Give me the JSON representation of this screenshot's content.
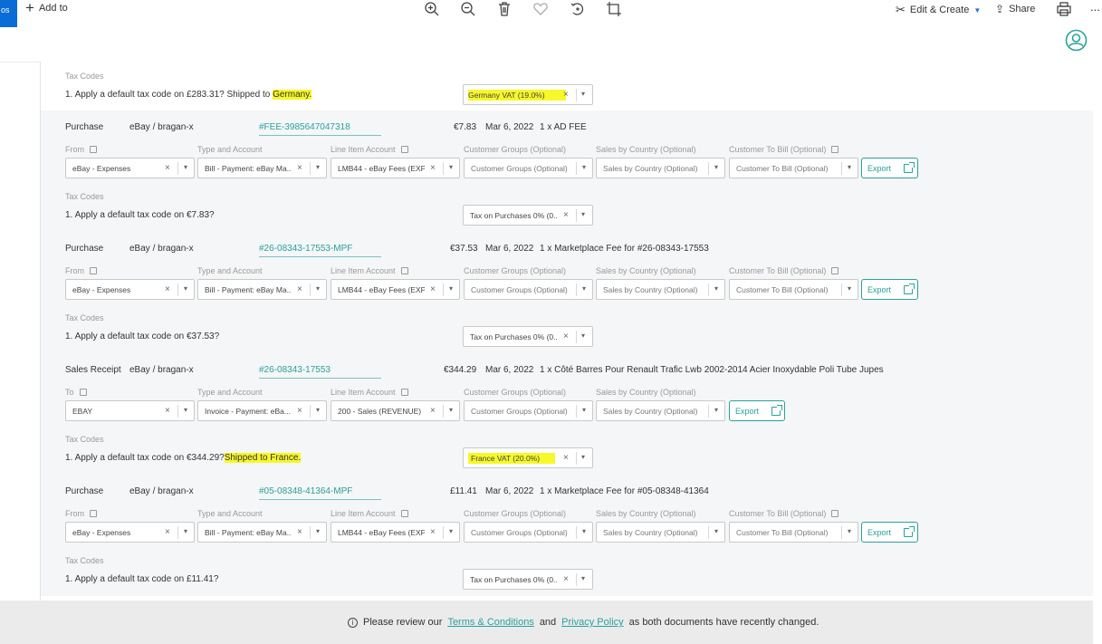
{
  "toolbar": {
    "left_fragment": "os",
    "add_to": "Add to",
    "edit_create": "Edit & Create",
    "share": "Share",
    "more": "..."
  },
  "first_tax": {
    "label": "Tax Codes",
    "question_prefix": "1. Apply a default tax code on £283.31? Shipped to ",
    "question_highlight": "Germany.",
    "select": "Germany VAT (19.0%)"
  },
  "labels": {
    "from": "From",
    "to": "To",
    "type_account": "Type and Account",
    "line_item": "Line Item Account",
    "customer_groups": "Customer Groups (Optional)",
    "sales_country": "Sales by Country (Optional)",
    "customer_bill": "Customer To Bill (Optional)",
    "tax_codes": "Tax Codes",
    "export": "Export"
  },
  "transactions": [
    {
      "type": "Purchase",
      "account": "eBay / bragan-x",
      "ref": "#FEE-3985647047318",
      "amount": "€7.83",
      "date": "Mar 6, 2022",
      "desc": "1 x AD FEE",
      "from": "eBay - Expenses",
      "type_account": "Bill - Payment: eBay Ma...",
      "line_item": "LMB44 - eBay Fees (EXP...",
      "customer_groups": "Customer Groups (Optional)",
      "sales_country": "Sales by Country (Optional)",
      "customer_bill": "Customer To Bill (Optional)",
      "tax_q": "1. Apply a default tax code on €7.83?",
      "tax_q_hl": "",
      "tax_code": "Tax on Purchases 0% (0...."
    },
    {
      "type": "Purchase",
      "account": "eBay / bragan-x",
      "ref": "#26-08343-17553-MPF",
      "amount": "€37.53",
      "date": "Mar 6, 2022",
      "desc": "1 x Marketplace Fee for #26-08343-17553",
      "from": "eBay - Expenses",
      "type_account": "Bill - Payment: eBay Ma...",
      "line_item": "LMB44 - eBay Fees (EXP...",
      "customer_groups": "Customer Groups (Optional)",
      "sales_country": "Sales by Country (Optional)",
      "customer_bill": "Customer To Bill (Optional)",
      "tax_q": "1. Apply a default tax code on €37.53?",
      "tax_q_hl": "",
      "tax_code": "Tax on Purchases 0% (0...."
    },
    {
      "type": "Sales Receipt",
      "account": "eBay / bragan-x",
      "ref": "#26-08343-17553",
      "amount": "€344.29",
      "date": "Mar 6, 2022",
      "desc": "1 x Côté Barres Pour Renault Trafic Lwb 2002-2014 Acier Inoxydable Poli Tube Jupes",
      "from": "EBAY",
      "type_account": "Invoice - Payment: eBa...",
      "line_item": "200 - Sales (REVENUE)",
      "customer_groups": "Customer Groups (Optional)",
      "sales_country": "Sales by Country (Optional)",
      "customer_bill": "",
      "tax_q": "1. Apply a default tax code on €344.29?",
      "tax_q_hl": "Shipped to France.",
      "tax_code": "France VAT (20.0%)"
    },
    {
      "type": "Purchase",
      "account": "eBay / bragan-x",
      "ref": "#05-08348-41364-MPF",
      "amount": "£11.41",
      "date": "Mar 6, 2022",
      "desc": "1 x Marketplace Fee for #05-08348-41364",
      "from": "eBay - Expenses",
      "type_account": "Bill - Payment: eBay Ma...",
      "line_item": "LMB44 - eBay Fees (EXP...",
      "customer_groups": "Customer Groups (Optional)",
      "sales_country": "Sales by Country (Optional)",
      "customer_bill": "Customer To Bill (Optional)",
      "tax_q": "1. Apply a default tax code on £11.41?",
      "tax_q_hl": "",
      "tax_code": "Tax on Purchases 0% (0...."
    }
  ],
  "notice": {
    "prefix": "Please review our",
    "terms": "Terms & Conditions",
    "and": "and",
    "privacy": "Privacy Policy",
    "suffix": "as both documents have recently changed."
  },
  "colors": {
    "accent": "#2aa19a",
    "highlight": "#f7f72a",
    "toolbar_blue": "#0a6cd6"
  }
}
